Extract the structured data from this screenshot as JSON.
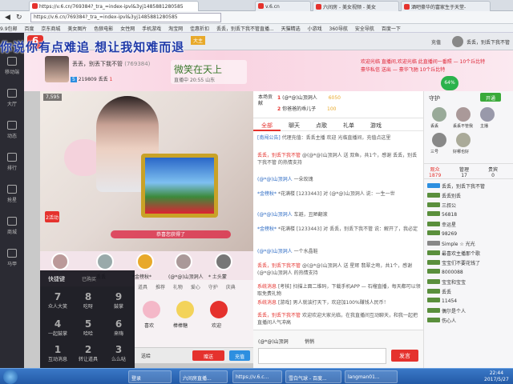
{
  "tabs": [
    {
      "label": "https://v.6.cn/769384?_tra_=index-ipvl&3yj1485881280585",
      "active": true
    },
    {
      "label": "v.6.cn",
      "active": false
    },
    {
      "label": "六间房 - 美女视频 - 美女",
      "active": false
    },
    {
      "label": "酒吧豪华的富家生于天堂-",
      "active": false
    }
  ],
  "address": "https://v.6.cn/769384?_tra_=index-ipvl&3yj1485881280585",
  "bookmarks": [
    "9.9包邮",
    "百度",
    "京东商城",
    "美女图片",
    "色狼电影",
    "女性网",
    "手机游戏",
    "淘宝网",
    "佳惠折扣",
    "丢丢，别丢下我不管直播...",
    "天猫精选",
    "小游戏",
    "360导航",
    "安全导航",
    "百度一下"
  ],
  "overlay_text": "你说你有点难追  想让我知难而退",
  "site": {
    "logo": "6",
    "room_label": "大主",
    "user": "丢丢，别丢下我不管"
  },
  "nav": [
    "移动端",
    "大厅",
    "动态",
    "排行",
    "抢星",
    "商城",
    "马甲"
  ],
  "host": {
    "name": "丢丢，别丢下我不管",
    "room_id": "(769384)",
    "level": "5",
    "fans": "219809",
    "title": "丢丢",
    "star": "1"
  },
  "banner": {
    "text": "微笑在天上",
    "live": "直播中",
    "time": "20:55",
    "city": "山东"
  },
  "notices": [
    "欢迎光临 直播间,欢迎光临 此直播间一番照 — 10个丘比特",
    "豪华私信 送出 — 豪华飞驰 10个丘比特"
  ],
  "video": {
    "viewers": "7,595",
    "status": "主播",
    "frame_text": "恭喜您获得了",
    "badge": "2活动"
  },
  "gifts_list": [
    "丢丢",
    "(@*@)山顶洞人",
    "*金榜秋*",
    "* 土头蒙"
  ],
  "quick": {
    "title": "快捷键",
    "tab2": "已购买",
    "keys": [
      {
        "k": "7",
        "l": "众人大笑"
      },
      {
        "k": "8",
        "l": "吃呀"
      },
      {
        "k": "9",
        "l": "鼓掌"
      },
      {
        "k": "4",
        "l": "一起鼓掌"
      },
      {
        "k": "5",
        "l": "哈哈"
      },
      {
        "k": "6",
        "l": "来嗨"
      },
      {
        "k": "1",
        "l": "互动消息"
      },
      {
        "k": "2",
        "l": "转让道具"
      },
      {
        "k": "3",
        "l": "么么哒"
      }
    ]
  },
  "gift_tabs": [
    "道具",
    "推荐",
    "礼物",
    "爱心",
    "守护",
    "庆典"
  ],
  "gift_items": [
    "喜欢",
    "棒棒糖",
    "欢迎"
  ],
  "input": {
    "placeholder": "送给",
    "send": "赠送",
    "action": "充值"
  },
  "rank": {
    "title": "本场贡献",
    "rows": [
      {
        "pos": "1",
        "name": "(@*@)山顶洞人",
        "value": "6050"
      },
      {
        "pos": "2",
        "name": "你爸爸的乖儿子",
        "value": "100"
      }
    ]
  },
  "chat_tabs": [
    "全部",
    "聊天",
    "点歌",
    "礼单",
    "游戏"
  ],
  "chat_tools": [
    "代理充值",
    "贵宾"
  ],
  "messages": [
    {
      "user": "[南闯公告]",
      "text": "代理充值：丢丢主播 欢迎 光临直播间，充值点这里"
    },
    {
      "user": "丢丢，别丢下我不管",
      "text": "@(@*@)山顶洞人 送 双鱼，共1个，感谢 丢丢，别丢下我不管 的热情支持"
    },
    {
      "user": "(@*@)山顶洞人",
      "text": "一朵玫瑰"
    },
    {
      "user": "*金榜秋*",
      "text": "*花满楼 [1233443] 对 (@*@)山顶洞人 说：一生一世"
    },
    {
      "user": "(@*@)山顶洞人",
      "text": "车避，丑陋翻滚"
    },
    {
      "user": "*金榜秋*",
      "text": "*花满楼 [1233443] 对 丢丢，别丢下我不管 说：解开了，我必定"
    },
    {
      "user": "(@*@)山顶洞人",
      "text": "一个水晶鞋"
    },
    {
      "user": "丢丢，别丢下我不管",
      "text": "@(@*@)山顶洞人 送 星辉 翡翠之吻，共1个，感谢 (@*@)山顶洞人 的热情支持"
    },
    {
      "user": "系统消息",
      "text": "[考核] 扫描上面二维码，下载手机APP — 石榴直播，每天都可以领取免费礼物"
    },
    {
      "user": "系统消息",
      "text": "[游戏] 男人就该打天下，欢迎加100%赚钱人民币！"
    },
    {
      "user": "丢丢，别丢下我不管",
      "text": "欢迎欢迎大家光临，在我直播间互动聊天，和我一起把直播间人气冲高"
    }
  ],
  "chat_input": {
    "target": "(@*@)山顶洞",
    "private": "悄悄",
    "send": "发言"
  },
  "side": {
    "guard_title": "守护",
    "open": "开通",
    "tabs": [
      {
        "label": "观众",
        "count": "1879"
      },
      {
        "label": "管理",
        "count": "17"
      },
      {
        "label": "贵宾",
        "count": "0"
      }
    ],
    "guards": [
      "丢丢",
      "丢丢不管我",
      "主播",
      "三号",
      "好哪也好"
    ],
    "users": [
      {
        "name": "丢丢，别丢下我不管",
        "level": "5"
      },
      {
        "name": "丢丢别丢",
        "level": "3"
      },
      {
        "name": "三叔公",
        "level": "1"
      },
      {
        "name": "56818",
        "level": ""
      },
      {
        "name": "幸运星",
        "level": ""
      },
      {
        "name": "98269",
        "level": ""
      },
      {
        "name": "Simple ☆ 光光",
        "level": ""
      },
      {
        "name": "最喜欢主播那个歌",
        "level": ""
      },
      {
        "name": "宝宝们不要花钱了",
        "level": ""
      },
      {
        "name": "8000088",
        "level": ""
      },
      {
        "name": "宝宝和宝宝",
        "level": ""
      },
      {
        "name": "丢丢",
        "level": ""
      },
      {
        "name": "11454",
        "level": ""
      },
      {
        "name": "偶尔是个人",
        "level": ""
      },
      {
        "name": "伤心人",
        "level": ""
      }
    ]
  },
  "taskbar": {
    "items": [
      "登录",
      "六间房直播...",
      "https://v.6.c...",
      "雪白气球 - 百度...",
      "langman01..."
    ],
    "time": "22:44",
    "date": "2017/5/27"
  }
}
